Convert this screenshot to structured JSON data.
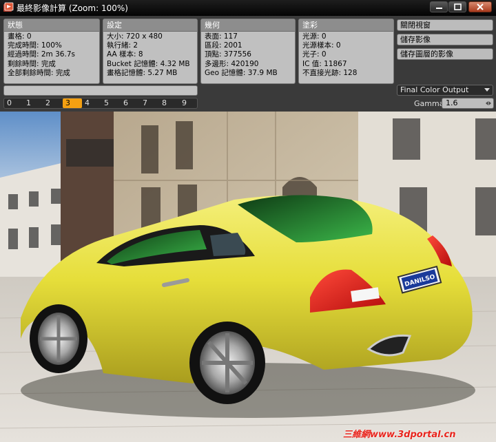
{
  "window": {
    "title": "最終影像計算 (Zoom: 100%)"
  },
  "panels": [
    {
      "title": "狀態",
      "lines": [
        "畫格: 0",
        "完成時間: 100%",
        "經過時間: 2m 36.7s",
        "剩餘時間: 完成",
        "全部剩餘時間: 完成"
      ]
    },
    {
      "title": "設定",
      "lines": [
        "大小: 720 x 480",
        "執行緒: 2",
        "AA 樣本: 8",
        "Bucket 記憶體: 4.32 MB",
        "畫格記憶體: 5.27 MB"
      ]
    },
    {
      "title": "幾何",
      "lines": [
        "表面: 117",
        "區段: 2001",
        "頂點: 377556",
        "多邊形: 420190",
        "Geo 記憶體: 37.9 MB"
      ]
    },
    {
      "title": "塗彩",
      "lines": [
        "光源: 0",
        "光源樣本: 0",
        "光子: 0",
        "IC 值: 11867",
        "不直接光跡: 128"
      ]
    }
  ],
  "actions": {
    "close_window": "關閉視窗",
    "save_image": "儲存影像",
    "save_layered_image": "儲存圖層的影像"
  },
  "progress": 1.0,
  "buffers": {
    "labels": [
      "0",
      "1",
      "2",
      "3",
      "4",
      "5",
      "6",
      "7",
      "8",
      "9"
    ],
    "active_index": 3
  },
  "output": {
    "selected": "Final Color Output",
    "gamma_label": "Gamma",
    "gamma_value": "1.6"
  },
  "render": {
    "plate_text": "DANILSO",
    "watermark": "三維網www.3dportal.cn"
  },
  "colors": {
    "accent": "#f4a012",
    "car_body": "#e6de3a",
    "taillight": "#e01818"
  }
}
